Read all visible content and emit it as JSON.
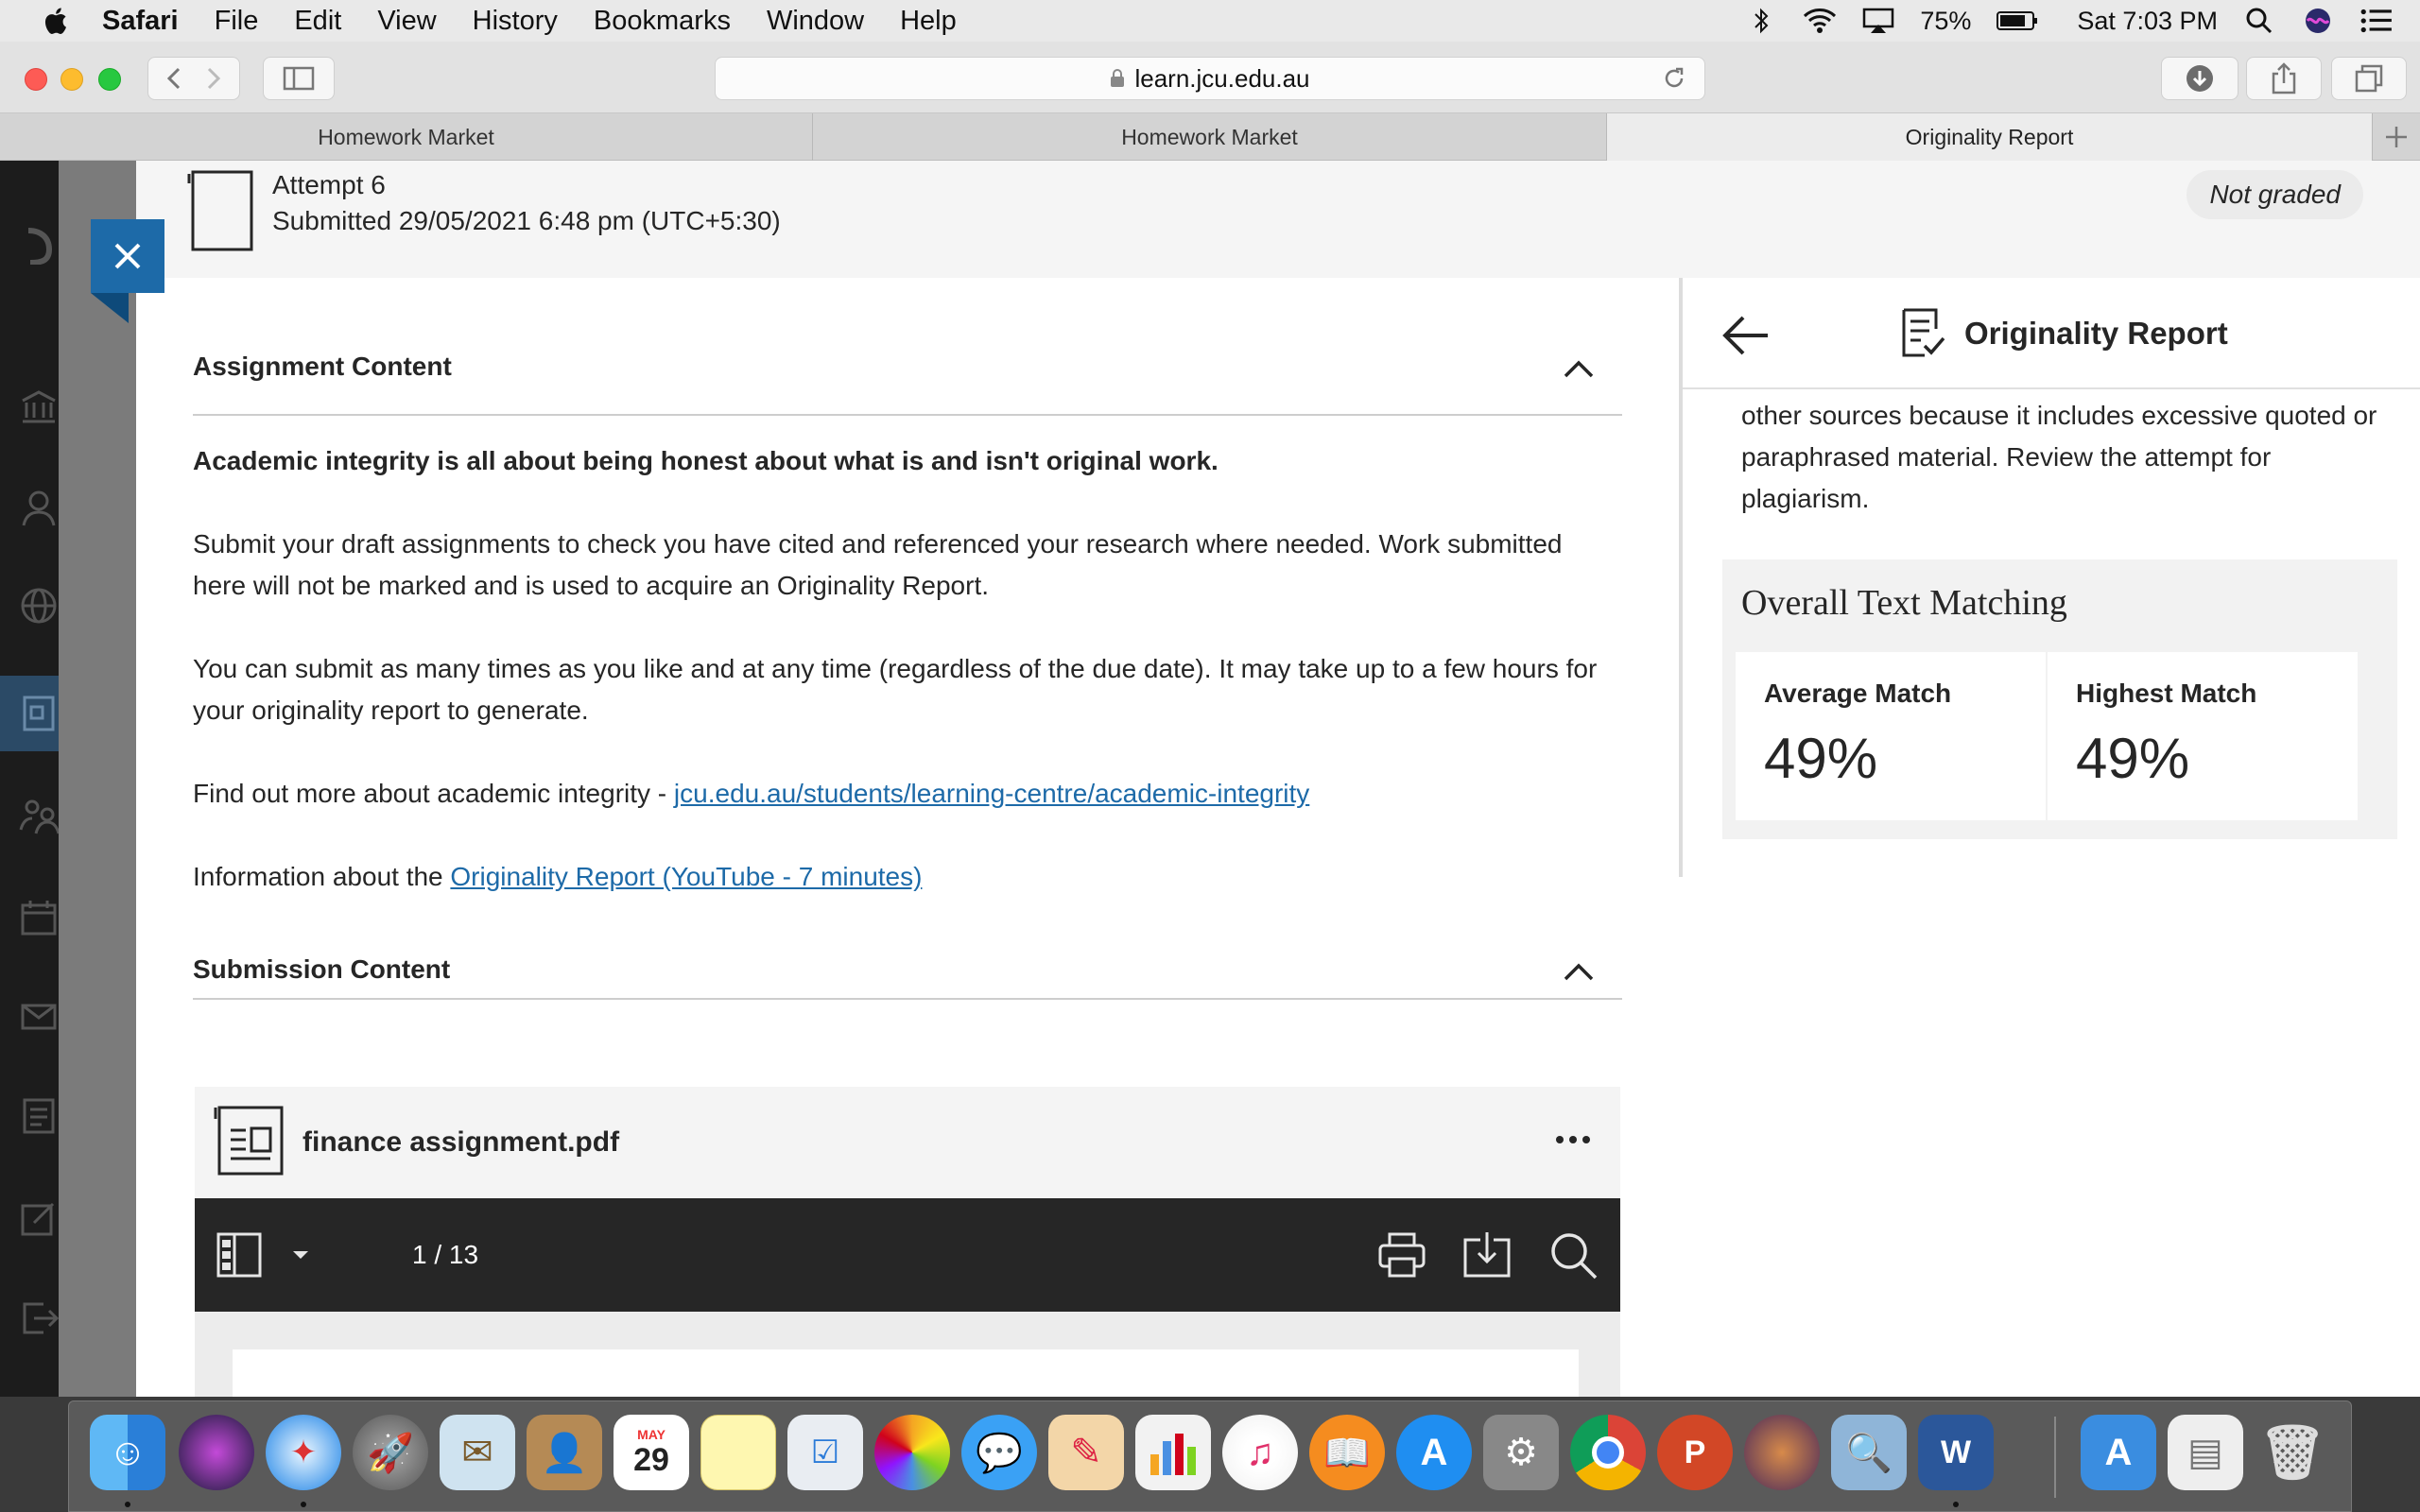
{
  "menubar": {
    "app": "Safari",
    "items": [
      "File",
      "Edit",
      "View",
      "History",
      "Bookmarks",
      "Window",
      "Help"
    ],
    "battery": "75%",
    "clock": "Sat 7:03 PM"
  },
  "browser": {
    "url": "learn.jcu.edu.au",
    "tabs": [
      "Homework Market",
      "Homework Market",
      "Originality Report"
    ],
    "active_tab": 2
  },
  "attempt": {
    "title": "Attempt 6",
    "submitted": "Submitted 29/05/2021 6:48 pm (UTC+5:30)",
    "grade_status": "Not graded"
  },
  "assignment": {
    "header": "Assignment Content",
    "intro_bold": "Academic integrity is all about being honest about what is and isn't original work.",
    "para1": "Submit your draft assignments to check you have cited and referenced your research where needed. Work submitted here will not be marked and is used to acquire an Originality Report.",
    "para2": "You can submit as many times as you like and at any time (regardless of the due date). It may take up to a few hours for your originality report to generate.",
    "para3_prefix": "Find out more about academic integrity - ",
    "para3_link": "jcu.edu.au/students/learning-centre/academic-integrity",
    "para4_prefix": "Information about the ",
    "para4_link": "Originality Report (YouTube - 7 minutes)"
  },
  "submission": {
    "header": "Submission Content",
    "file_name": "finance assignment.pdf",
    "page_indicator": "1 / 13"
  },
  "originality": {
    "title": "Originality Report",
    "text": "other sources because it includes excessive quoted or paraphrased material. Review the attempt for plagiarism.",
    "section_title": "Overall Text Matching",
    "average_label": "Average Match",
    "average_value": "49%",
    "highest_label": "Highest Match",
    "highest_value": "49%"
  },
  "dock": {
    "calendar_month": "MAY",
    "calendar_day": "29"
  },
  "colors": {
    "accent": "#1d6aa8",
    "sidebar": "#1c1c1c",
    "pdf_toolbar": "#262626"
  }
}
